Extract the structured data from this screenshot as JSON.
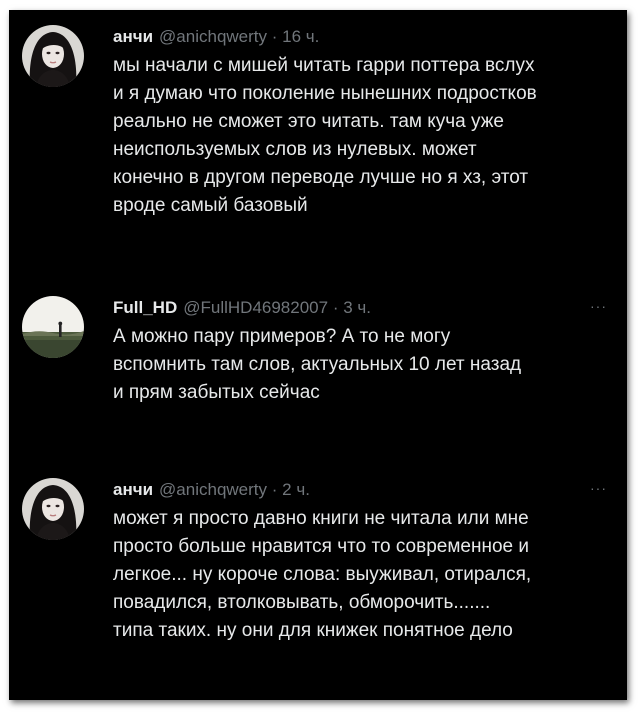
{
  "tweets": [
    {
      "name": "анчи",
      "handle": "@anichqwerty",
      "separator": "·",
      "time": "16 ч.",
      "more": "",
      "avatar_icon": "avatar-girl-dark-hair",
      "lines": [
        "мы начали с мишей читать гарри поттера вслух",
        "и я думаю что поколение нынешних подростков",
        "реально не сможет это читать. там куча уже",
        "неиспользуемых слов из нулевых. может",
        "конечно в другом переводе лучше но я хз, этот",
        "вроде самый базовый"
      ]
    },
    {
      "name": "Full_HD",
      "handle": "@FullHD46982007",
      "separator": "·",
      "time": "3 ч.",
      "more": "···",
      "avatar_icon": "avatar-landscape-figure",
      "lines": [
        "А можно пару примеров? А то не могу",
        "вспомнить там слов, актуальных 10 лет назад",
        "и прям забытых сейчас"
      ]
    },
    {
      "name": "анчи",
      "handle": "@anichqwerty",
      "separator": "·",
      "time": "2 ч.",
      "more": "···",
      "avatar_icon": "avatar-girl-dark-hair",
      "lines": [
        "может я просто давно книги не читала или мне",
        "просто больше нравится что то современное и",
        "легкое... ну короче слова: выуживал, отирался,",
        "повадился, втолковывать, обморочить.......",
        "типа таких. ну они для книжек понятное дело"
      ]
    }
  ],
  "colors": {
    "background": "#000000",
    "text": "#e7e9ea",
    "muted": "#71767b",
    "page": "#ffffff"
  }
}
